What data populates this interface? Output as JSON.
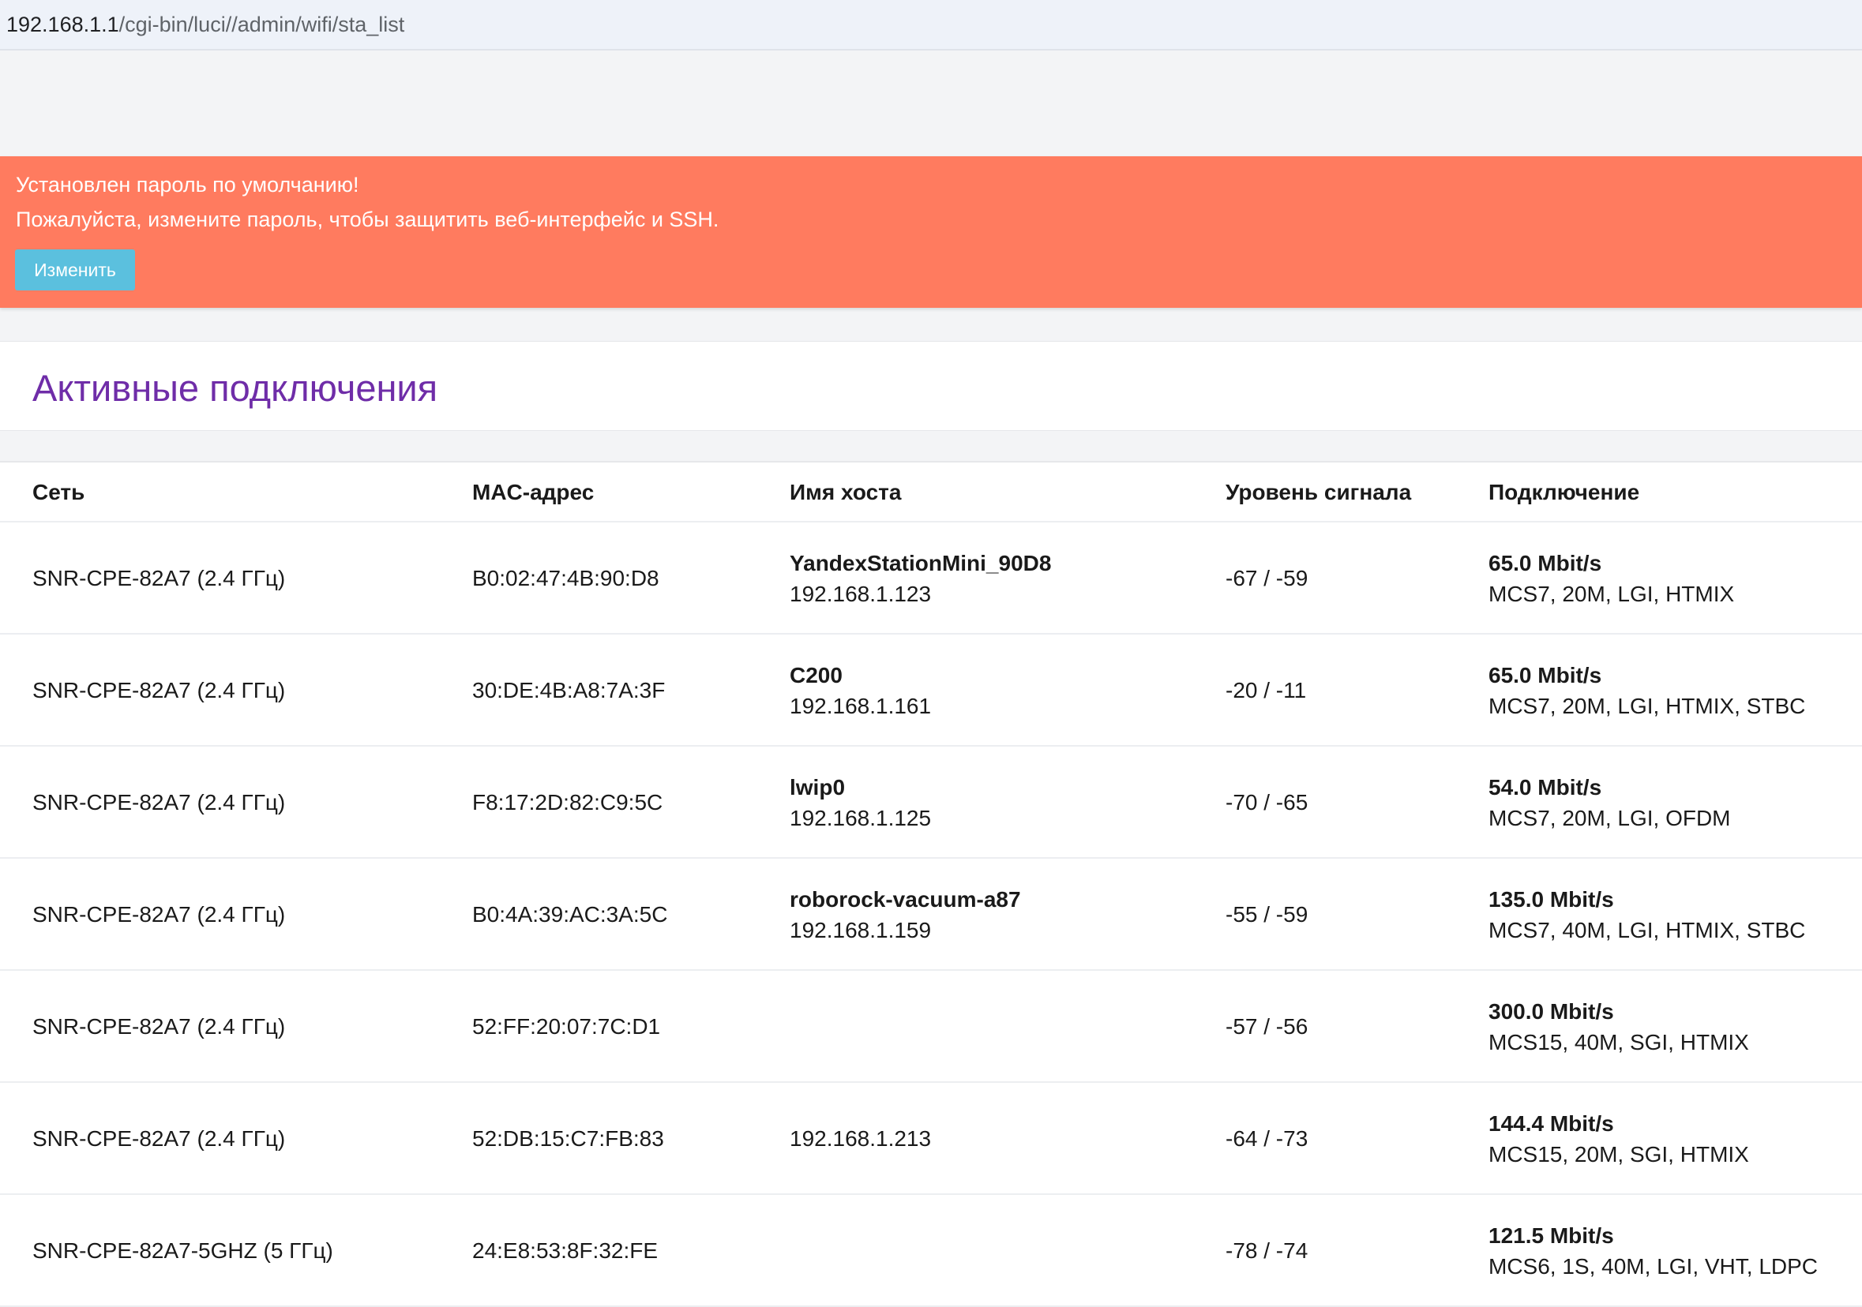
{
  "browser": {
    "url_host": "192.168.1.1",
    "url_path": "/cgi-bin/luci//admin/wifi/sta_list"
  },
  "banner": {
    "line1": "Установлен пароль по умолчанию!",
    "line2": "Пожалуйста, измените пароль, чтобы защитить веб-интерфейс и SSH.",
    "button_label": "Изменить"
  },
  "page": {
    "title": "Активные подключения"
  },
  "table": {
    "headers": {
      "network": "Сеть",
      "mac": "MAC-адрес",
      "hostname": "Имя хоста",
      "signal": "Уровень сигнала",
      "connection": "Подключение"
    },
    "rows": [
      {
        "network": "SNR-CPE-82A7 (2.4 ГГц)",
        "mac": "B0:02:47:4B:90:D8",
        "hostname": "YandexStationMini_90D8",
        "ip": "192.168.1.123",
        "signal": "-67 / -59",
        "rate": "65.0 Mbit/s",
        "details": "MCS7, 20M, LGI, HTMIX"
      },
      {
        "network": "SNR-CPE-82A7 (2.4 ГГц)",
        "mac": "30:DE:4B:A8:7A:3F",
        "hostname": "C200",
        "ip": "192.168.1.161",
        "signal": "-20 / -11",
        "rate": "65.0 Mbit/s",
        "details": "MCS7, 20M, LGI, HTMIX, STBC"
      },
      {
        "network": "SNR-CPE-82A7 (2.4 ГГц)",
        "mac": "F8:17:2D:82:C9:5C",
        "hostname": "lwip0",
        "ip": "192.168.1.125",
        "signal": "-70 / -65",
        "rate": "54.0 Mbit/s",
        "details": "MCS7, 20M, LGI, OFDM"
      },
      {
        "network": "SNR-CPE-82A7 (2.4 ГГц)",
        "mac": "B0:4A:39:AC:3A:5C",
        "hostname": "roborock-vacuum-a87",
        "ip": "192.168.1.159",
        "signal": "-55 / -59",
        "rate": "135.0 Mbit/s",
        "details": "MCS7, 40M, LGI, HTMIX, STBC"
      },
      {
        "network": "SNR-CPE-82A7 (2.4 ГГц)",
        "mac": "52:FF:20:07:7C:D1",
        "hostname": "",
        "ip": "",
        "signal": "-57 / -56",
        "rate": "300.0 Mbit/s",
        "details": "MCS15, 40M, SGI, HTMIX"
      },
      {
        "network": "SNR-CPE-82A7 (2.4 ГГц)",
        "mac": "52:DB:15:C7:FB:83",
        "hostname": "",
        "ip": "192.168.1.213",
        "signal": "-64 / -73",
        "rate": "144.4 Mbit/s",
        "details": "MCS15, 20M, SGI, HTMIX"
      },
      {
        "network": "SNR-CPE-82A7-5GHZ (5 ГГц)",
        "mac": "24:E8:53:8F:32:FE",
        "hostname": "",
        "ip": "",
        "signal": "-78 / -74",
        "rate": "121.5 Mbit/s",
        "details": "MCS6, 1S, 40M, LGI, VHT, LDPC"
      }
    ]
  }
}
